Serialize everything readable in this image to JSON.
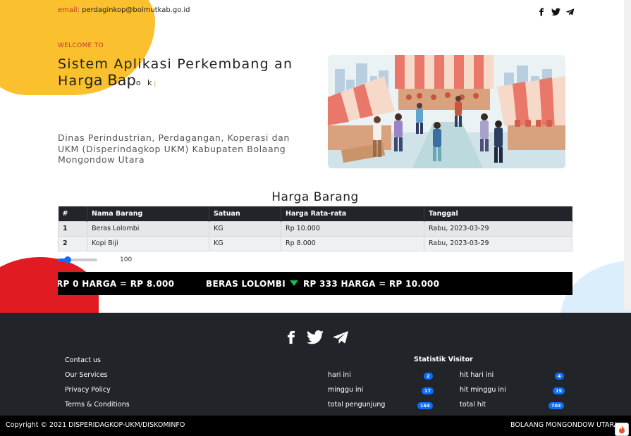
{
  "topbar": {
    "email_label": "email:",
    "email": "perdaginkop@bolmutkab.go.id"
  },
  "social_icons": [
    "facebook-icon",
    "twitter-icon",
    "telegram-icon"
  ],
  "hero": {
    "welcome": "WELCOME TO",
    "title_part1": "Sistem Aplikasi Perkembang an Har",
    "title_part2": "ga Bap",
    "title_part3": "o k",
    "title_cursor": "|",
    "subtitle": "Dinas Perindustrian, Perdagangan, Koperasi dan UKM (Disperindagkop UKM) Kabupaten Bolaang Mongondow Utara",
    "image": "market-illustration"
  },
  "table": {
    "title": "Harga Barang",
    "headers": [
      "#",
      "Nama Barang",
      "Satuan",
      "Harga Rata-rata",
      "Tanggal"
    ],
    "rows": [
      [
        "1",
        "Beras Lolombi",
        "KG",
        "Rp 10.000",
        "Rabu, 2023-03-29"
      ],
      [
        "2",
        "Kopi Biji",
        "KG",
        "Rp 8.000",
        "Rabu, 2023-03-29"
      ]
    ]
  },
  "slider": {
    "value": "100",
    "fill_fraction": 0.25
  },
  "ticker": {
    "seg1": "RP 0 HARGA = RP 8.000",
    "seg2_item": "BERAS LOLOMBI",
    "seg2_change": "RP 333 HARGA = RP 10.000",
    "down_color": "#1db954"
  },
  "footer": {
    "links": [
      "Contact us",
      "Our Services",
      "Privacy Policy",
      "Terms & Conditions"
    ],
    "stats_title": "Statistik Visitor",
    "stats": [
      {
        "label": "hari ini",
        "value": "2"
      },
      {
        "label": "minggu ini",
        "value": "17"
      },
      {
        "label": "total pengunjung",
        "value": "154"
      },
      {
        "label": "hit hari ini",
        "value": "4"
      },
      {
        "label": "hit minggu ini",
        "value": "15"
      },
      {
        "label": "total hit",
        "value": "703"
      }
    ],
    "copyright": "Copyright © 2021 DISPERIDAGKOP-UKM/DISKOMINFO",
    "region": "BOLAANG MONGONDOW UTARA"
  },
  "colors": {
    "accent_yellow": "#fbc02d",
    "accent_red": "#e01b22",
    "badge_blue": "#0d6efd",
    "dark": "#212529"
  }
}
